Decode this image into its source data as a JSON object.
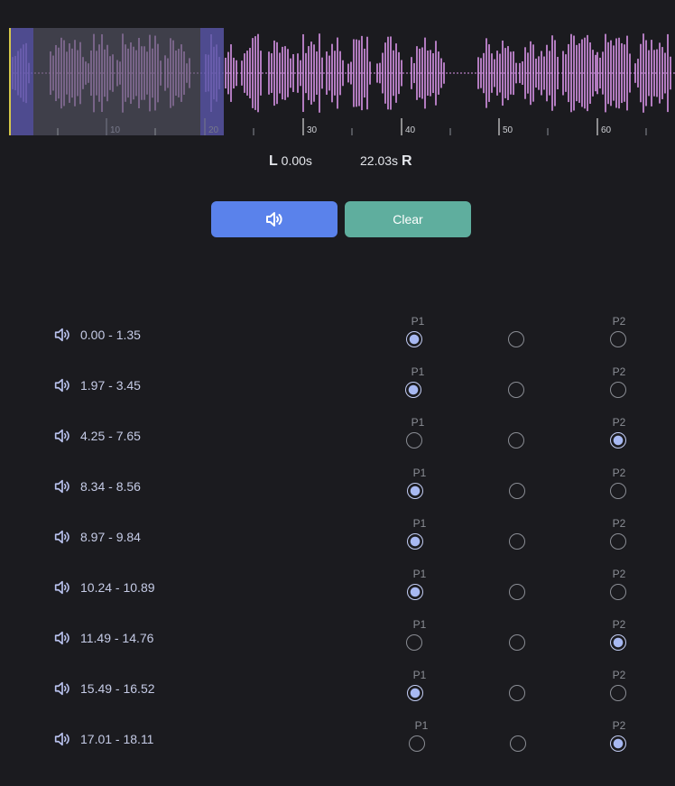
{
  "waveform": {
    "ticks": [
      "10",
      "20",
      "30",
      "40",
      "50",
      "60"
    ],
    "colors": {
      "wave": "#d894e8",
      "region": "#555566",
      "region_edge": "#5b56c8",
      "tick": "#ffffff",
      "marker": "#d6c74a"
    }
  },
  "readout": {
    "left_letter": "L",
    "left_time": "0.00s",
    "right_time": "22.03s",
    "right_letter": "R"
  },
  "controls": {
    "play_icon": "speaker-icon",
    "clear_label": "Clear"
  },
  "segments": [
    {
      "range": "0.00 - 1.35",
      "p1_label": "P1",
      "p2_label": "P2",
      "selected": "P1"
    },
    {
      "range": "1.97 - 3.45",
      "p1_label": "P1",
      "p2_label": "P2",
      "selected": "P1"
    },
    {
      "range": "4.25 - 7.65",
      "p1_label": "P1",
      "p2_label": "P2",
      "selected": "P2"
    },
    {
      "range": "8.34 - 8.56",
      "p1_label": "P1",
      "p2_label": "P2",
      "selected": "P1"
    },
    {
      "range": "8.97 - 9.84",
      "p1_label": "P1",
      "p2_label": "P2",
      "selected": "P1"
    },
    {
      "range": "10.24 - 10.89",
      "p1_label": "P1",
      "p2_label": "P2",
      "selected": "P1"
    },
    {
      "range": "11.49 - 14.76",
      "p1_label": "P1",
      "p2_label": "P2",
      "selected": "P2"
    },
    {
      "range": "15.49 - 16.52",
      "p1_label": "P1",
      "p2_label": "P2",
      "selected": "P1"
    },
    {
      "range": "17.01 - 18.11",
      "p1_label": "P1",
      "p2_label": "P2",
      "selected": "P2"
    }
  ]
}
